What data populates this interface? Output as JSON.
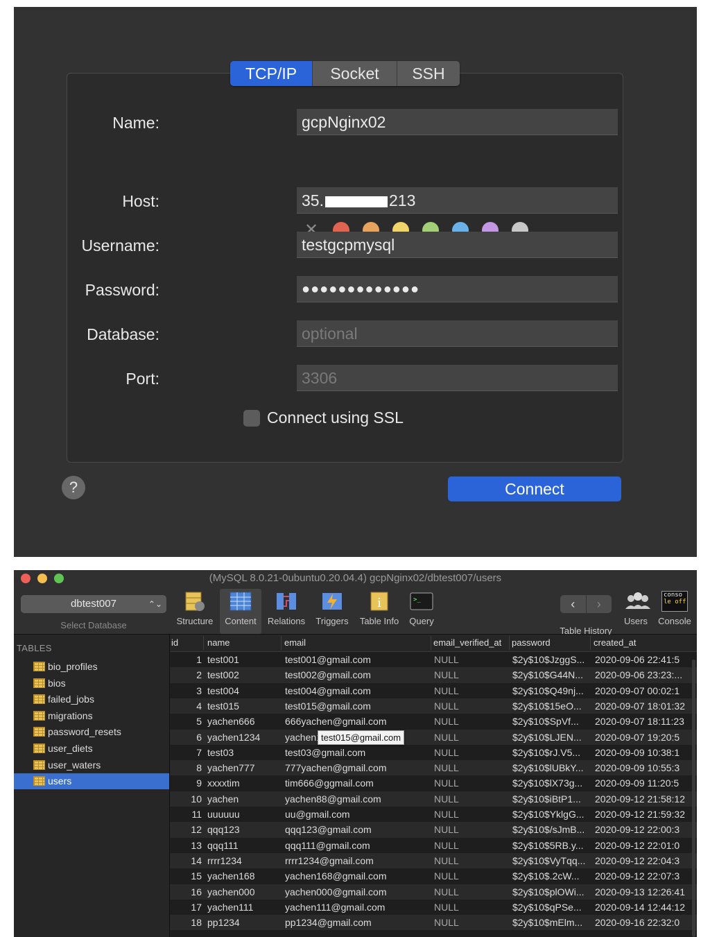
{
  "connection": {
    "tabs": [
      {
        "label": "TCP/IP",
        "active": true
      },
      {
        "label": "Socket",
        "active": false
      },
      {
        "label": "SSH",
        "active": false
      }
    ],
    "fields": {
      "name": {
        "label": "Name:",
        "value": "gcpNginx02"
      },
      "host": {
        "label": "Host:",
        "value_prefix": "35.",
        "value_suffix": "213"
      },
      "username": {
        "label": "Username:",
        "value": "testgcpmysql"
      },
      "password": {
        "label": "Password:",
        "value": "●●●●●●●●●●●●●"
      },
      "database": {
        "label": "Database:",
        "placeholder": "optional"
      },
      "port": {
        "label": "Port:",
        "placeholder": "3306"
      }
    },
    "color_swatches": [
      "#e0644f",
      "#e8a45d",
      "#efd46a",
      "#a3d076",
      "#6ab1ea",
      "#c497e4",
      "#c8c8c8"
    ],
    "ssl_label": "Connect using SSL",
    "ssl_checked": false,
    "help_label": "?",
    "connect_label": "Connect"
  },
  "window": {
    "title": "(MySQL 8.0.21-0ubuntu0.20.04.4) gcpNginx02/dbtest007/users",
    "database_select": "dbtest007",
    "database_caption": "Select Database",
    "toolbar": {
      "structure": "Structure",
      "content": "Content",
      "relations": "Relations",
      "triggers": "Triggers",
      "table_info": "Table Info",
      "query": "Query",
      "table_history": "Table History",
      "users": "Users",
      "console": "Console"
    },
    "console_icon_text_1": "conso",
    "console_icon_text_2": "le off"
  },
  "sidebar": {
    "heading": "TABLES",
    "tables": [
      "bio_profiles",
      "bios",
      "failed_jobs",
      "migrations",
      "password_resets",
      "user_diets",
      "user_waters",
      "users"
    ],
    "selected": "users"
  },
  "grid": {
    "columns": [
      "id",
      "name",
      "email",
      "email_verified_at",
      "password",
      "created_at"
    ],
    "rows": [
      [
        "1",
        "test001",
        "test001@gmail.com",
        "NULL",
        "$2y$10$JzggS...",
        "2020-09-06 22:41:5"
      ],
      [
        "2",
        "test002",
        "test002@gmail.com",
        "NULL",
        "$2y$10$G44N...",
        "2020-09-06 23:23:..."
      ],
      [
        "3",
        "test004",
        "test004@gmail.com",
        "NULL",
        "$2y$10$Q49nj...",
        "2020-09-07 00:02:1"
      ],
      [
        "4",
        "test015",
        "test015@gmail.com",
        "NULL",
        "$2y$10$15eO...",
        "2020-09-07 18:01:32"
      ],
      [
        "5",
        "yachen666",
        "666yachen@gmail.com",
        "NULL",
        "$2y$10$SpVf...",
        "2020-09-07 18:11:23"
      ],
      [
        "6",
        "yachen1234",
        "yachen1234@gmail.com",
        "NULL",
        "$2y$10$LJEN...",
        "2020-09-07 19:20:5"
      ],
      [
        "7",
        "test03",
        "test03@gmail.com",
        "NULL",
        "$2y$10$rJ.V5...",
        "2020-09-09 10:38:1"
      ],
      [
        "8",
        "yachen777",
        "777yachen@gmail.com",
        "NULL",
        "$2y$10$lUBkY...",
        "2020-09-09 10:55:3"
      ],
      [
        "9",
        "xxxxtim",
        "tim666@ggmail.com",
        "NULL",
        "$2y$10$lX73g...",
        "2020-09-09 11:20:5"
      ],
      [
        "10",
        "yachen",
        "yachen88@gmail.com",
        "NULL",
        "$2y$10$iBtP1...",
        "2020-09-12 21:58:12"
      ],
      [
        "11",
        "uuuuuu",
        "uu@gmail.com",
        "NULL",
        "$2y$10$YklgG...",
        "2020-09-12 21:59:32"
      ],
      [
        "12",
        "qqq123",
        "qqq123@gmail.com",
        "NULL",
        "$2y$10$/sJmB...",
        "2020-09-12 22:00:3"
      ],
      [
        "13",
        "qqq111",
        "qqq111@gmail.com",
        "NULL",
        "$2y$10$5RB.y...",
        "2020-09-12 22:01:0"
      ],
      [
        "14",
        "rrrr1234",
        "rrrr1234@gmail.com",
        "NULL",
        "$2y$10$VyTqq...",
        "2020-09-12 22:04:3"
      ],
      [
        "15",
        "yachen168",
        "yachen168@gmail.com",
        "NULL",
        "$2y$10$.2cW...",
        "2020-09-12 22:07:3"
      ],
      [
        "16",
        "yachen000",
        "yachen000@gmail.com",
        "NULL",
        "$2y$10$plOWi...",
        "2020-09-13 12:26:41"
      ],
      [
        "17",
        "yachen111",
        "yachen111@gmail.com",
        "NULL",
        "$2y$10$qPSe...",
        "2020-09-14 12:44:12"
      ],
      [
        "18",
        "pp1234",
        "pp1234@gmail.com",
        "NULL",
        "$2y$10$mElm...",
        "2020-09-16 22:32:0"
      ]
    ],
    "tooltip": "test015@gmail.com"
  }
}
